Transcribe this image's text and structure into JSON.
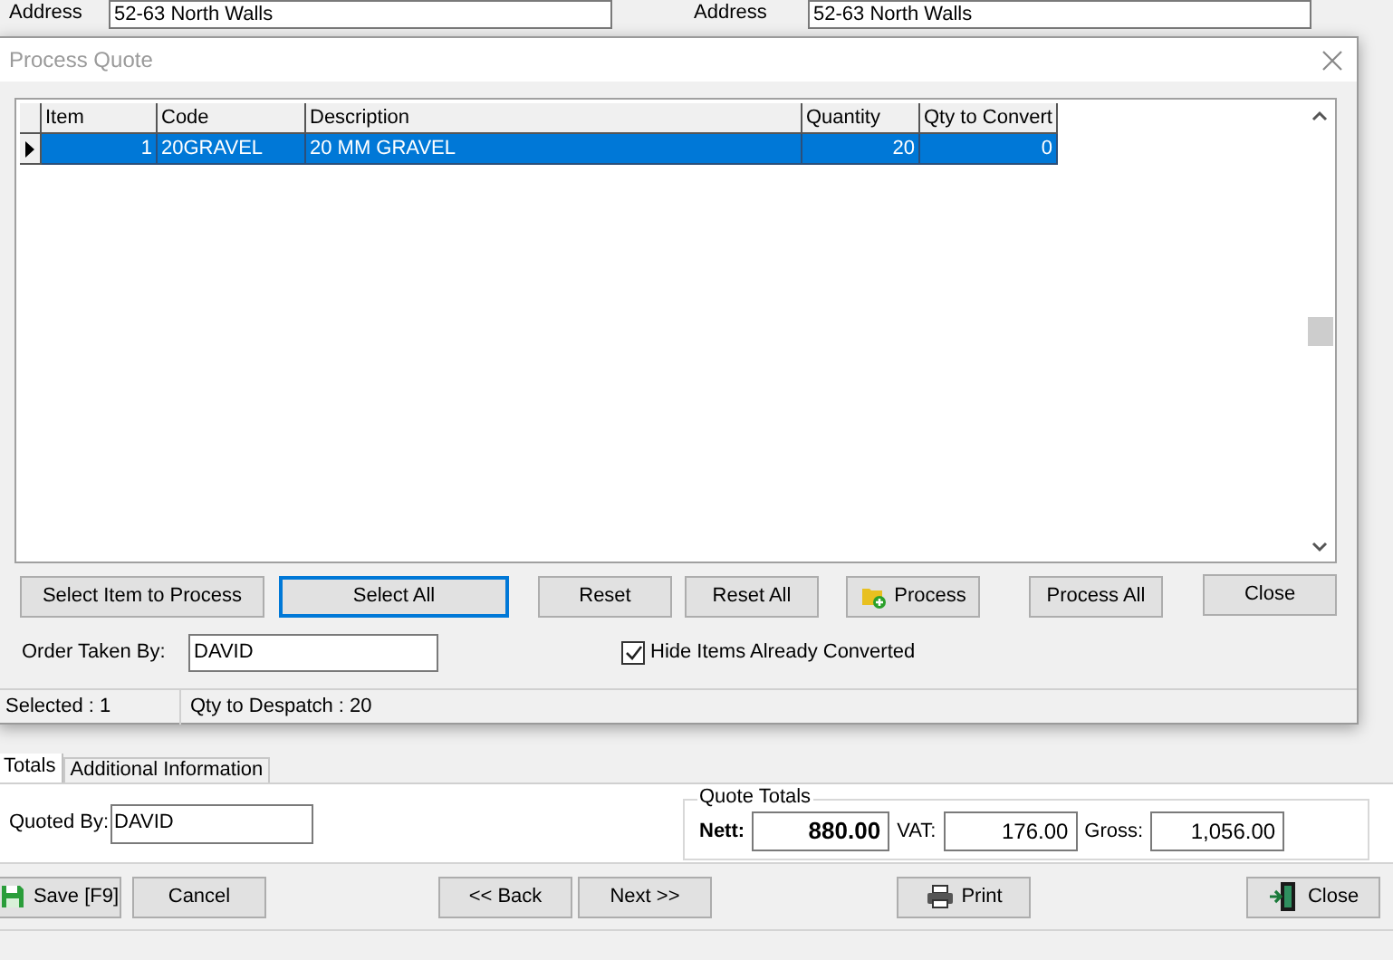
{
  "background": {
    "address_fields": [
      {
        "label": "Address",
        "value": "52-63 North Walls"
      },
      {
        "label": "Address",
        "value": "52-63 North Walls"
      }
    ],
    "tabs": [
      {
        "label": "Totals",
        "selected": true
      },
      {
        "label": "Additional Information",
        "selected": false
      }
    ],
    "quoted_by": {
      "label": "Quoted By:",
      "value": "DAVID"
    },
    "quote_totals": {
      "title": "Quote Totals",
      "fields": [
        {
          "label": "Nett:",
          "value": "880.00",
          "bold": true
        },
        {
          "label": "VAT:",
          "value": "176.00",
          "bold": false
        },
        {
          "label": "Gross:",
          "value": "1,056.00",
          "bold": false
        }
      ]
    },
    "buttons": [
      {
        "label": "Save [F9]",
        "kind": "save"
      },
      {
        "label": "Cancel",
        "kind": "plain"
      },
      {
        "label": "<< Back",
        "kind": "plain"
      },
      {
        "label": "Next >>",
        "kind": "plain"
      },
      {
        "label": "Print",
        "kind": "print"
      },
      {
        "label": "Close",
        "kind": "exit"
      }
    ]
  },
  "dialog": {
    "title": "Process Quote",
    "columns": [
      "Item",
      "Code",
      "Description",
      "Quantity",
      "Qty to Convert"
    ],
    "rows": [
      {
        "item": "1",
        "code": "20GRAVEL",
        "description": "20 MM GRAVEL",
        "quantity": "20",
        "qty_to_convert": "0",
        "selected": true
      }
    ],
    "buttons": [
      {
        "label": "Select Item to Process",
        "kind": "plain",
        "focused": false
      },
      {
        "label": "Select All",
        "kind": "plain",
        "focused": true
      },
      {
        "label": "Reset",
        "kind": "plain",
        "focused": false
      },
      {
        "label": "Reset All",
        "kind": "plain",
        "focused": false
      },
      {
        "label": "Process",
        "kind": "process",
        "focused": false
      },
      {
        "label": "Process All",
        "kind": "plain",
        "focused": false
      },
      {
        "label": "Close",
        "kind": "plain",
        "focused": false
      }
    ],
    "order_taken_by": {
      "label": "Order Taken By:",
      "value": "DAVID"
    },
    "hide_converted": {
      "label": "Hide Items Already Converted",
      "checked": true
    },
    "status_bar": [
      "Selected : 1",
      "Qty to Despatch : 20"
    ]
  }
}
